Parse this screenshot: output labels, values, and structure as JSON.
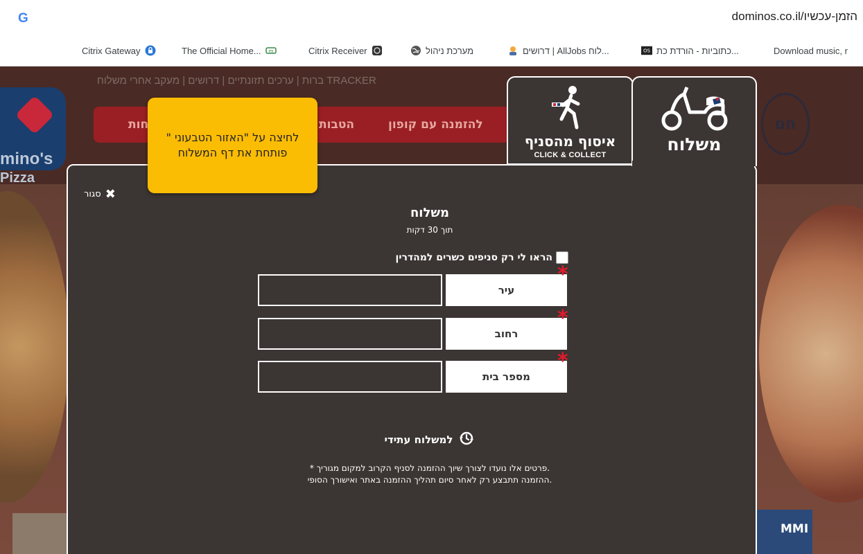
{
  "browser": {
    "google_logo": "G",
    "url": "dominos.co.il/הזמן-עכשיו"
  },
  "bookmarks": [
    {
      "label": "Citrix Gateway",
      "icon": "lock-icon"
    },
    {
      "label": "The Official Home...",
      "icon": "site-icon"
    },
    {
      "label": "Citrix Receiver",
      "icon": "citrix-icon"
    },
    {
      "label": "מערכת ניהול",
      "icon": "globe-icon"
    },
    {
      "label": "דרושים | AllJobs לוח...",
      "icon": "alljobs-icon"
    },
    {
      "label": "כתוביות - הורדת כת...",
      "icon": "subtitles-icon"
    },
    {
      "label": "Download music, r",
      "icon": "music-icon"
    }
  ],
  "site": {
    "nav_text": "ברות | ערכים תזונתיים | דרושים | מעקב אחרי משלוח TRACKER",
    "redbar_items": [
      "לחות",
      "הטבות",
      "להזמנה עם קופון"
    ],
    "logo_word": "mino's",
    "logo_word2": "Pizza",
    "right_badge": "חם",
    "bottom_right_card": "MMI"
  },
  "tabs": {
    "delivery_label": "משלוח",
    "pickup_label": "איסוף מהסניף",
    "pickup_sub": "CLICK & COLLECT"
  },
  "modal": {
    "close_label": "סגור",
    "title": "משלוח",
    "subtitle": "תוך 30 דקות",
    "kosher_label": "הראו לי רק סניפים כשרים למהדרין",
    "fields": [
      {
        "label": "עיר",
        "value": "",
        "placeholder": ""
      },
      {
        "label": "רחוב",
        "value": "",
        "placeholder": ""
      },
      {
        "label": "מספר בית",
        "value": "",
        "placeholder": ""
      }
    ],
    "future_delivery_label": "למשלוח עתידי",
    "disclaimer_line1": "* פרטים אלו נועדו לצורך שיוך ההזמנה לסניף הקרוב למקום מגוריך.",
    "disclaimer_line2": "ההזמנה תתבצע רק לאחר סיום תהליך ההזמנה באתר ואישורך הסופי."
  },
  "tooltip": {
    "text": "לחיצה על \"האזור הטבעוני \" פותחת את דף המשלוח"
  },
  "colors": {
    "modal_bg": "#3b3533",
    "tooltip_bg": "#fbbc04",
    "required_star": "#e21a2c",
    "domino_blue": "#1a3e6e",
    "domino_red": "#c9273a"
  }
}
